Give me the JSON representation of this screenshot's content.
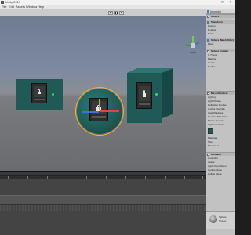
{
  "window": {
    "title": "Unity 2017",
    "minimize": "–",
    "maximize": "□",
    "close": "×"
  },
  "menu": [
    "File",
    "Edit",
    "Assets",
    "Window",
    "Help"
  ],
  "gizmo": {
    "view_label": "Persp"
  },
  "inspector": {
    "tab_label": "Inspector",
    "object_name": "Sphere",
    "sections": [
      {
        "name": "Transform"
      },
      {
        "name": "Position",
        "type": "field"
      },
      {
        "name": "Rotation",
        "type": "field"
      },
      {
        "name": "Scale",
        "type": "field"
      },
      {
        "name": "Sphere (Mesh Filter)"
      },
      {
        "name": "Mesh",
        "type": "field"
      },
      {
        "name": "Sphere Collider"
      },
      {
        "name": "Is Trigger",
        "type": "field"
      },
      {
        "name": "Material",
        "type": "field"
      },
      {
        "name": "Center",
        "type": "field"
      },
      {
        "name": "Radius",
        "type": "field"
      },
      {
        "name": "Mesh Renderer"
      },
      {
        "name": "Lighting",
        "type": "field"
      },
      {
        "name": "Light Probes",
        "type": "field"
      },
      {
        "name": "Reflection Probes",
        "type": "field"
      },
      {
        "name": "Anchor Override",
        "type": "field"
      },
      {
        "name": "Cast Shadows",
        "type": "field"
      },
      {
        "name": "Receive Shadows",
        "type": "field"
      },
      {
        "name": "Motion Vectors",
        "type": "field"
      },
      {
        "name": "Lightmap Static",
        "type": "field"
      },
      {
        "name": "Materials",
        "type": "field"
      },
      {
        "name": "Size",
        "type": "field"
      },
      {
        "name": "Element 0",
        "type": "field"
      },
      {
        "name": "Animator"
      },
      {
        "name": "Controller",
        "type": "field"
      },
      {
        "name": "Avatar",
        "type": "field"
      },
      {
        "name": "Apply Root Motion",
        "type": "field"
      },
      {
        "name": "Update Mode",
        "type": "field"
      },
      {
        "name": "Culling Mode",
        "type": "field"
      }
    ],
    "material": {
      "name": "Sphere",
      "shader": "Shader"
    }
  },
  "colors": {
    "panel_teal": "#1f5a56",
    "selection_orange": "#ffb020",
    "axis_x": "#d8493b",
    "axis_y": "#84c44a",
    "axis_z": "#3b74d8",
    "status_green": "#3cd16b"
  },
  "icons": {
    "play": "play-icon",
    "pause": "pause-icon",
    "step": "step-icon",
    "lock": "lock-icon",
    "gizmo": "scene-orientation-gizmo"
  }
}
